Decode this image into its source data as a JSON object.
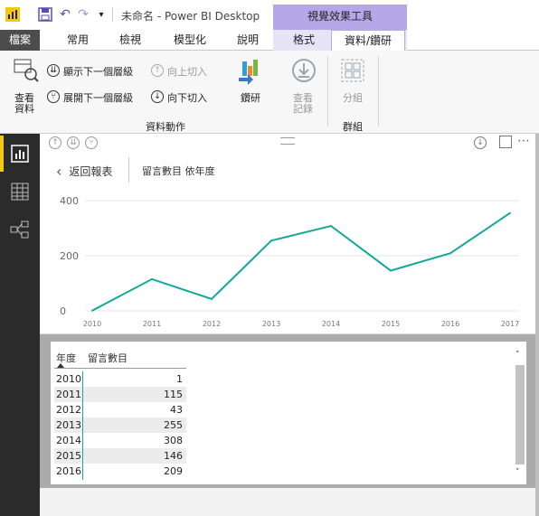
{
  "titlebar": {
    "title": "未命名 - Power BI Desktop",
    "context_group": "視覺效果工具"
  },
  "tabs": [
    {
      "label": "檔案"
    },
    {
      "label": "常用"
    },
    {
      "label": "檢視"
    },
    {
      "label": "模型化"
    },
    {
      "label": "說明"
    },
    {
      "label": "格式"
    },
    {
      "label": "資料/鑽研"
    }
  ],
  "ribbon": {
    "see_data_label_1": "查看",
    "see_data_label_2": "資料",
    "show_next_level": "顯示下一個層級",
    "expand_next_level": "展開下一個層級",
    "drill_up": "向上切入",
    "drill_down": "向下切入",
    "drill_through": "鑽研",
    "see_records_1": "查看",
    "see_records_2": "記錄",
    "data_actions_group": "資料動作",
    "group_btn": "分組",
    "groups_group": "群組"
  },
  "visual": {
    "back_label": "返回報表",
    "title": "留言數目 依年度"
  },
  "chart_data": {
    "type": "line",
    "x": [
      "2010",
      "2011",
      "2012",
      "2013",
      "2014",
      "2015",
      "2016",
      "2017"
    ],
    "y_ticks": [
      "0",
      "200",
      "400"
    ],
    "ylim": [
      0,
      400
    ],
    "series": [
      {
        "values": [
          1,
          115,
          43,
          255,
          308,
          146,
          209,
          355
        ]
      }
    ],
    "line_color": "#14a89a",
    "grid": true
  },
  "table": {
    "headers": [
      "年度",
      "留言數目"
    ],
    "rows": [
      {
        "year": "2010",
        "count": "1"
      },
      {
        "year": "2011",
        "count": "115"
      },
      {
        "year": "2012",
        "count": "43"
      },
      {
        "year": "2013",
        "count": "255"
      },
      {
        "year": "2014",
        "count": "308"
      },
      {
        "year": "2015",
        "count": "146"
      },
      {
        "year": "2016",
        "count": "209"
      }
    ]
  }
}
